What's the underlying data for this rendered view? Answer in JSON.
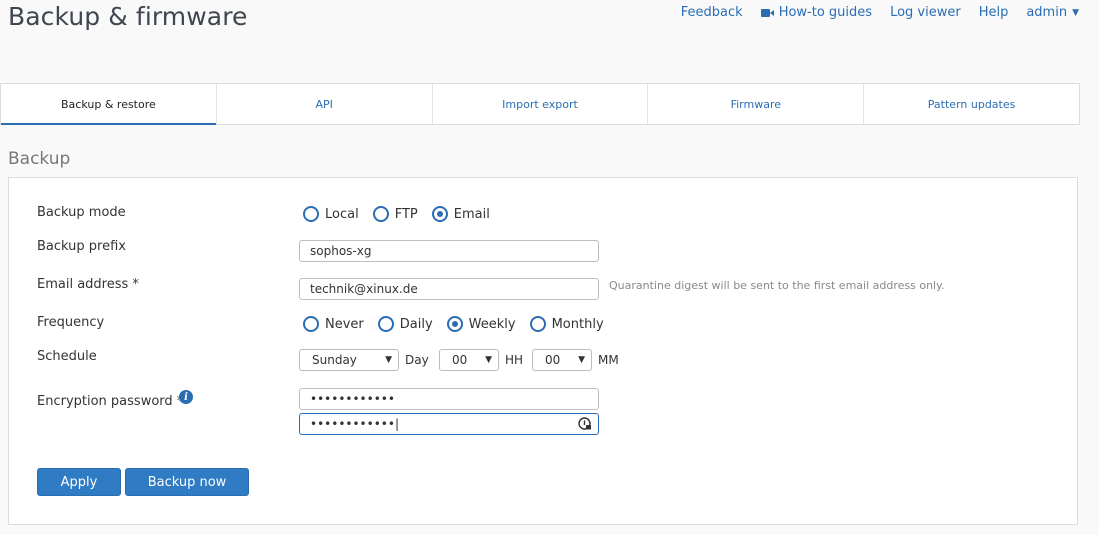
{
  "page": {
    "title": "Backup & firmware"
  },
  "topnav": {
    "feedback": "Feedback",
    "howto": "How-to guides",
    "logviewer": "Log viewer",
    "help": "Help",
    "admin": "admin"
  },
  "tabs": [
    {
      "label": "Backup & restore",
      "active": true
    },
    {
      "label": "API"
    },
    {
      "label": "Import export"
    },
    {
      "label": "Firmware"
    },
    {
      "label": "Pattern updates"
    }
  ],
  "section": {
    "title": "Backup"
  },
  "form": {
    "mode_label": "Backup mode",
    "mode_options": [
      "Local",
      "FTP",
      "Email"
    ],
    "mode_selected": "Email",
    "prefix_label": "Backup prefix",
    "prefix_value": "sophos-xg",
    "email_label": "Email address *",
    "email_value": "technik@xinux.de",
    "email_hint": "Quarantine digest will be sent to the first email address only.",
    "freq_label": "Frequency",
    "freq_options": [
      "Never",
      "Daily",
      "Weekly",
      "Monthly"
    ],
    "freq_selected": "Weekly",
    "schedule_label": "Schedule",
    "day_value": "Sunday",
    "day_unit": "Day",
    "hour_value": "00",
    "hour_unit": "HH",
    "min_value": "00",
    "min_unit": "MM",
    "enc_label": "Encryption password *",
    "pw1": "••••••••••••",
    "pw2": "••••••••••••|"
  },
  "buttons": {
    "apply": "Apply",
    "backup_now": "Backup now"
  },
  "colors": {
    "accent": "#2a6db3",
    "button": "#2f7bc4"
  }
}
